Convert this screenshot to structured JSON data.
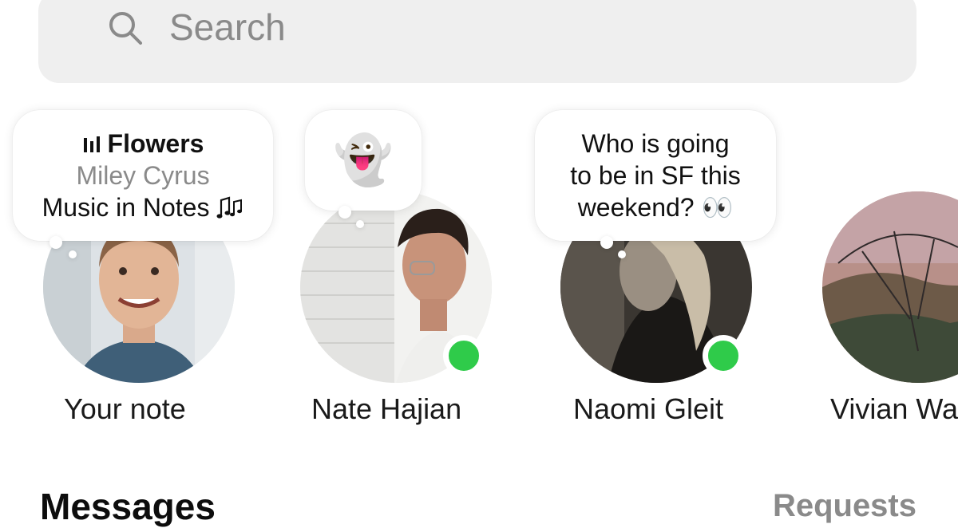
{
  "search": {
    "placeholder": "Search"
  },
  "notes": [
    {
      "name": "Your note",
      "note_title": "Flowers",
      "note_artist": "Miley Cyrus",
      "note_caption": "Music in Notes",
      "note_icon": "music-bars-icon",
      "online": false
    },
    {
      "name": "Nate Hajian",
      "note_emoji": "👻",
      "online": true
    },
    {
      "name": "Naomi Gleit",
      "note_lines": [
        "Who is going",
        "to be in SF this",
        "weekend? 👀"
      ],
      "online": true
    },
    {
      "name": "Vivian Wa",
      "online": false
    }
  ],
  "messages": {
    "title": "Messages",
    "requests_label": "Requests"
  },
  "colors": {
    "online": "#2fcb4a",
    "search_bg": "#efefef",
    "muted": "#8a8a8a"
  }
}
